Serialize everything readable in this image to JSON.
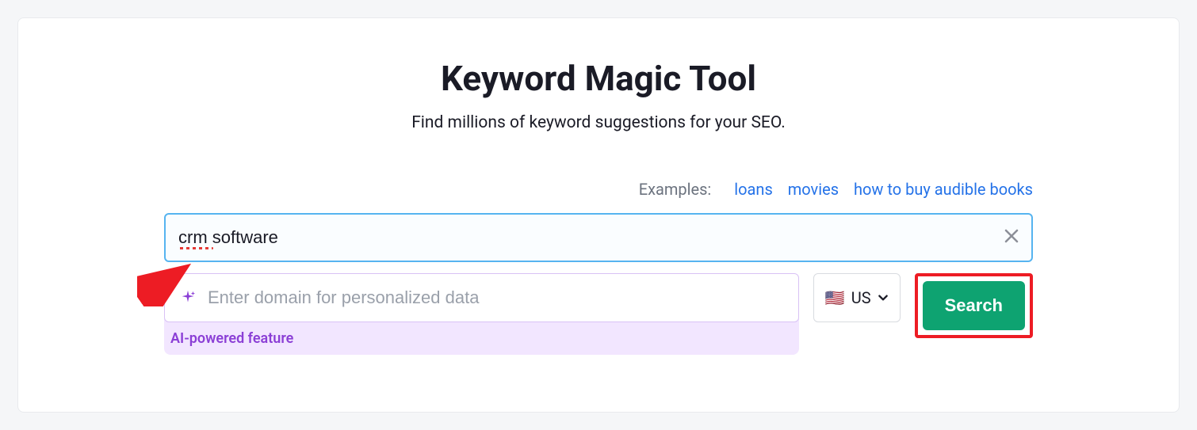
{
  "header": {
    "title": "Keyword Magic Tool",
    "subtitle": "Find millions of keyword suggestions for your SEO."
  },
  "examples": {
    "label": "Examples:",
    "links": [
      "loans",
      "movies",
      "how to buy audible books"
    ]
  },
  "keyword_input": {
    "value": "crm software"
  },
  "domain_input": {
    "placeholder": "Enter domain for personalized data",
    "ai_label": "AI-powered feature"
  },
  "country": {
    "flag": "🇺🇸",
    "code": "US"
  },
  "search_button": {
    "label": "Search"
  }
}
